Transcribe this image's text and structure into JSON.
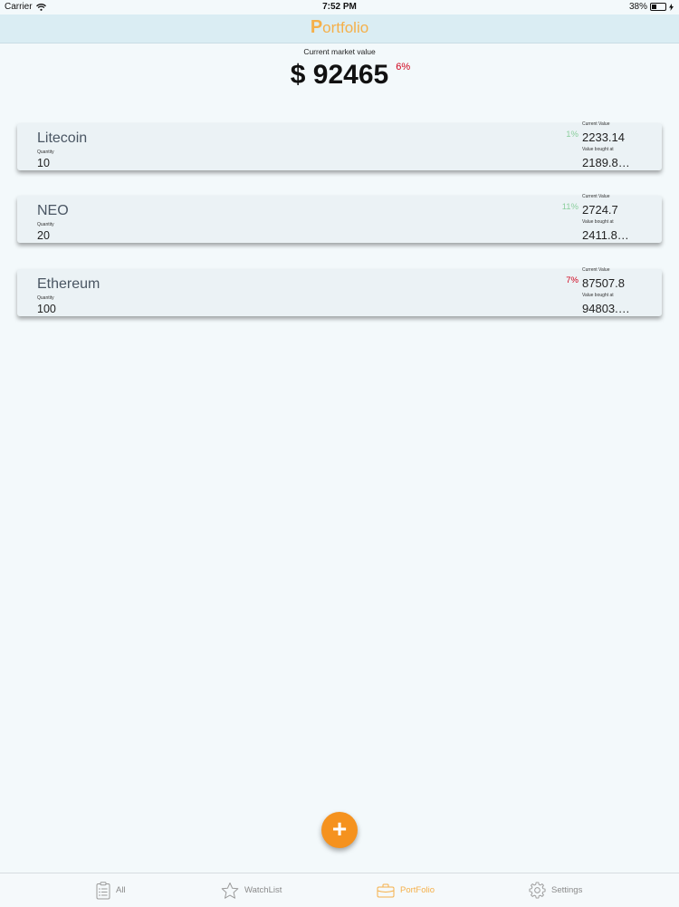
{
  "status_bar": {
    "carrier": "Carrier",
    "time": "7:52 PM",
    "battery": "38%",
    "battery_level": 0.38
  },
  "nav": {
    "title_first": "P",
    "title_rest": "ortfolio"
  },
  "summary": {
    "label": "Current market value",
    "value": "$ 92465",
    "change": "6%",
    "change_color": "#d0021b"
  },
  "holdings": [
    {
      "name": "Litecoin",
      "quantity_label": "Quantity",
      "quantity": "10",
      "change": "1%",
      "direction": "up",
      "current_value_label": "Current Value",
      "current_value": "2233.14",
      "bought_label": "Value bought at",
      "bought_value": "2189.8…"
    },
    {
      "name": "NEO",
      "quantity_label": "Quantity",
      "quantity": "20",
      "change": "11%",
      "direction": "up",
      "current_value_label": "Current Value",
      "current_value": "2724.7",
      "bought_label": "Value bought at",
      "bought_value": "2411.8…"
    },
    {
      "name": "Ethereum",
      "quantity_label": "Quantity",
      "quantity": "100",
      "change": "7%",
      "direction": "down",
      "current_value_label": "Current Value",
      "current_value": "87507.8",
      "bought_label": "Value bought at",
      "bought_value": "94803.…"
    }
  ],
  "fab": {
    "icon": "plus-icon",
    "label": "+"
  },
  "tabs": [
    {
      "label": "All",
      "icon": "clipboard-list-icon",
      "active": false
    },
    {
      "label": "WatchList",
      "icon": "star-icon",
      "active": false
    },
    {
      "label": "PortFolio",
      "icon": "briefcase-icon",
      "active": true
    },
    {
      "label": "Settings",
      "icon": "gear-icon",
      "active": false
    }
  ],
  "colors": {
    "accent": "#f5b04a",
    "gain": "#8ccf9e",
    "loss": "#d0021b",
    "fab": "#f5921e"
  }
}
